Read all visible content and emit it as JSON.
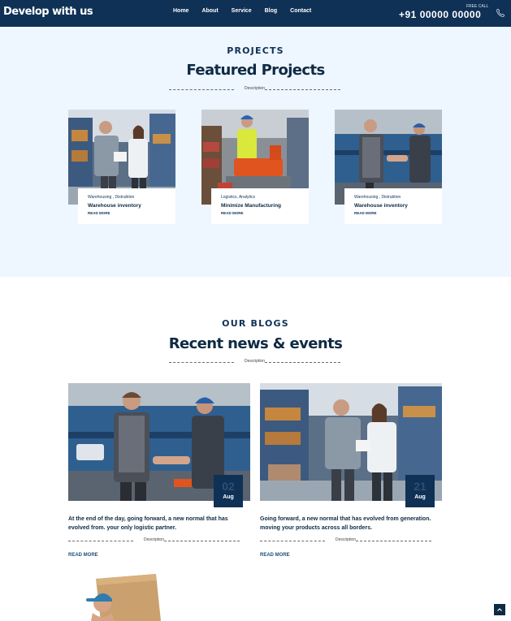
{
  "header": {
    "brand": "Develop with us",
    "nav": [
      "Home",
      "About",
      "Service",
      "Blog",
      "Contact"
    ],
    "free_call_label": "FREE CALL",
    "phone": "+91 00000 00000"
  },
  "projects": {
    "eyebrow": "PROJECTS",
    "title": "Featured Projects",
    "divider_label": "Description",
    "cards": [
      {
        "category": "Warehousing , Distrubtion",
        "name": "Warehouse inventory",
        "more": "READ MORE"
      },
      {
        "category": "Logistics, Analytics",
        "name": "Minimize Manufacturing",
        "more": "READ MORE"
      },
      {
        "category": "Warehousing , Distrubtion",
        "name": "Warehouse inventory",
        "more": "READ MORE"
      }
    ]
  },
  "blogs": {
    "eyebrow": "OUR BLOGS",
    "title": "Recent news & events",
    "divider_label": "Description",
    "posts": [
      {
        "day": "02",
        "month": "Aug",
        "text": "At the end of the day, going forward, a new normal that has evolved from. your only logistic partner.",
        "divider_label": "Description",
        "more": "READ MORE"
      },
      {
        "day": "21",
        "month": "Aug",
        "text": "Going forward, a new normal that has evolved from generation. moving your products across all borders.",
        "divider_label": "Description",
        "more": "READ MORE"
      }
    ]
  },
  "icons": {
    "phone": "phone-icon",
    "scroll_top": "chevron-up-icon"
  }
}
